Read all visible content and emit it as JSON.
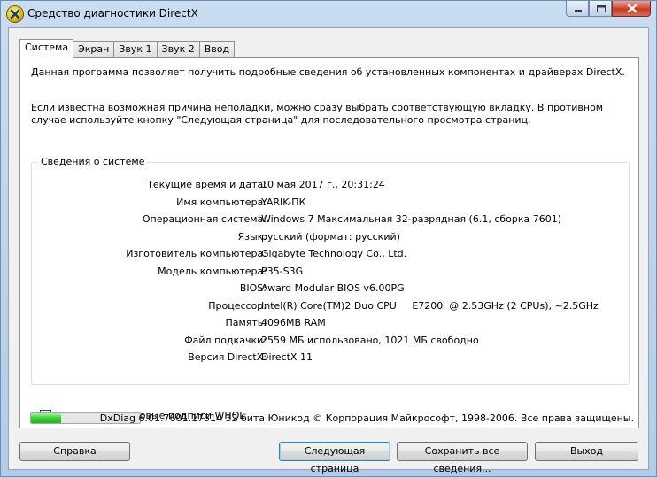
{
  "window": {
    "title": "Средство диагностики DirectX"
  },
  "tabs": [
    {
      "label": "Система",
      "active": true
    },
    {
      "label": "Экран",
      "active": false
    },
    {
      "label": "Звук 1",
      "active": false
    },
    {
      "label": "Звук 2",
      "active": false
    },
    {
      "label": "Ввод",
      "active": false
    }
  ],
  "intro": {
    "line1": "Данная программа позволяет получить подробные сведения об установленных компонентах и драйверах DirectX.",
    "line2": "Если известна возможная причина неполадки, можно сразу выбрать соответствующую вкладку. В противном случае используйте кнопку \"Следующая страница\" для последовательного просмотра страниц."
  },
  "system_info": {
    "title": "Сведения о системе",
    "rows": [
      {
        "label": "Текущие время и дата:",
        "value": "10 мая 2017 г., 20:31:24"
      },
      {
        "label": "Имя компьютера:",
        "value": "YARIK-ПК"
      },
      {
        "label": "Операционная система:",
        "value": "Windows 7 Максимальная 32-разрядная (6.1, сборка 7601)"
      },
      {
        "label": "Язык:",
        "value": "русский (формат: русский)"
      },
      {
        "label": "Изготовитель компьютера:",
        "value": "Gigabyte Technology Co., Ltd."
      },
      {
        "label": "Модель компьютера:",
        "value": "P35-S3G"
      },
      {
        "label": "BIOS:",
        "value": "Award Modular BIOS v6.00PG"
      },
      {
        "label": "Процессор:",
        "value": "Intel(R) Core(TM)2 Duo CPU     E7200  @ 2.53GHz (2 CPUs), ~2.5GHz"
      },
      {
        "label": "Память:",
        "value": "4096MB RAM"
      },
      {
        "label": "Файл подкачки:",
        "value": "2559 МБ использовано, 1021 МБ свободно"
      },
      {
        "label": "Версия DirectX:",
        "value": "DirectX 11"
      }
    ]
  },
  "whql": {
    "label": "Проверить цифровые подписи WHQL",
    "checked": true
  },
  "progress": {
    "fraction": 0.28
  },
  "footer": {
    "text": "DxDiag 6.01.7601.17514 32 бита Юникод  © Корпорация Майкрософт, 1998-2006.  Все права защищены."
  },
  "buttons": {
    "help": "Справка",
    "next": "Следующая страница",
    "save": "Сохранить все сведения...",
    "exit": "Выход"
  }
}
